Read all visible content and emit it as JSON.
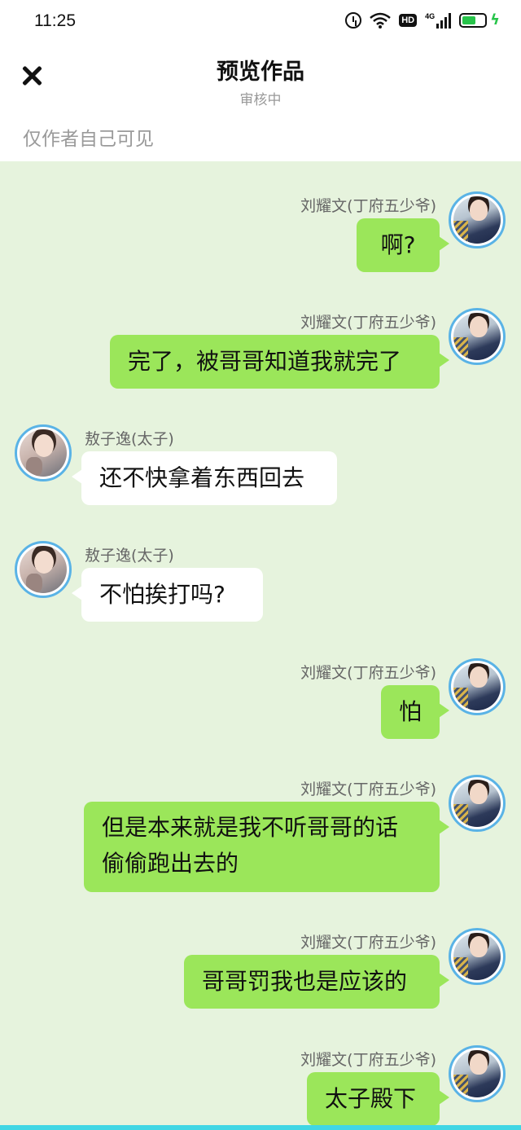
{
  "status_bar": {
    "time": "11:25",
    "hd_label": "HD",
    "network_label": "4G",
    "battery_color": "#27c44a"
  },
  "header": {
    "title": "预览作品",
    "subtitle": "审核中",
    "visibility": "仅作者自己可见"
  },
  "messages": [
    {
      "side": "right",
      "name": "刘耀文(丁府五少爷)",
      "text": "啊?"
    },
    {
      "side": "right",
      "name": "刘耀文(丁府五少爷)",
      "text": "完了，被哥哥知道我就完了"
    },
    {
      "side": "left",
      "name": "敖子逸(太子)",
      "text": "还不快拿着东西回去"
    },
    {
      "side": "left",
      "name": "敖子逸(太子)",
      "text": "不怕挨打吗?"
    },
    {
      "side": "right",
      "name": "刘耀文(丁府五少爷)",
      "text": "怕"
    },
    {
      "side": "right",
      "name": "刘耀文(丁府五少爷)",
      "text_line1": "但是本来就是我不听哥哥的话",
      "text_line2": "偷偷跑出去的"
    },
    {
      "side": "right",
      "name": "刘耀文(丁府五少爷)",
      "text": "哥哥罚我也是应该的"
    },
    {
      "side": "right",
      "name": "刘耀文(丁府五少爷)",
      "text": "太子殿下"
    }
  ],
  "colors": {
    "chat_background": "#e6f3dd",
    "own_bubble": "#9be65a",
    "other_bubble": "#ffffff",
    "avatar_border": "#5ab3e6"
  }
}
